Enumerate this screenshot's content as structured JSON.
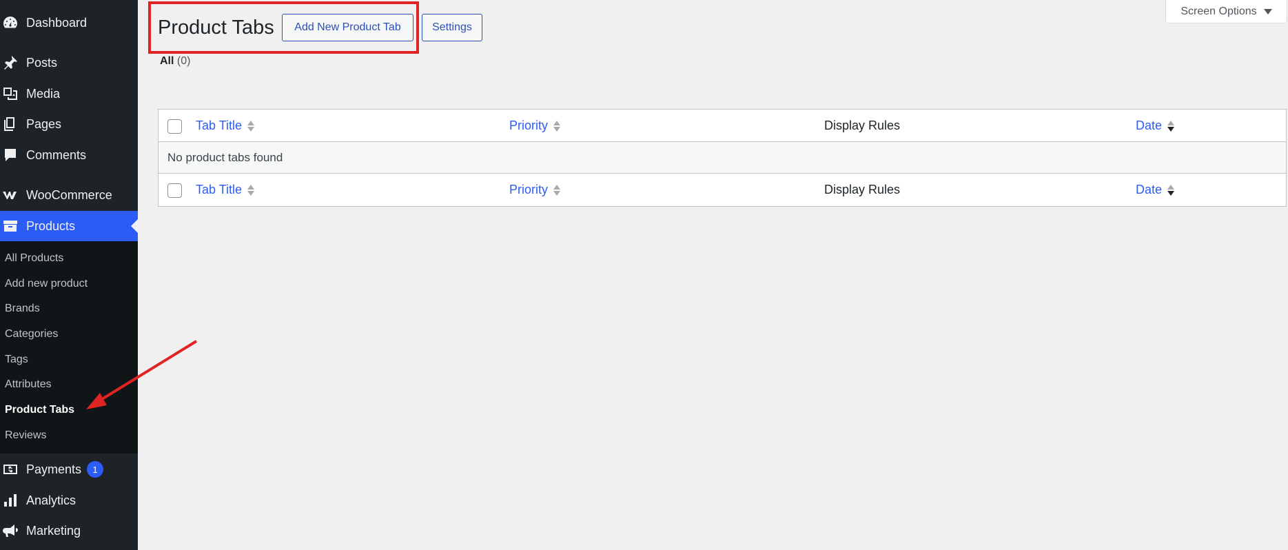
{
  "sidebar": {
    "items": [
      {
        "label": "Dashboard",
        "icon": "dashboard-icon"
      },
      {
        "label": "Posts",
        "icon": "pin-icon"
      },
      {
        "label": "Media",
        "icon": "media-icon"
      },
      {
        "label": "Pages",
        "icon": "pages-icon"
      },
      {
        "label": "Comments",
        "icon": "comment-icon"
      },
      {
        "label": "WooCommerce",
        "icon": "woocommerce-icon"
      },
      {
        "label": "Products",
        "icon": "archive-icon"
      },
      {
        "label": "Payments",
        "icon": "payments-icon",
        "badge": "1"
      },
      {
        "label": "Analytics",
        "icon": "bar-chart-icon"
      },
      {
        "label": "Marketing",
        "icon": "megaphone-icon"
      }
    ],
    "submenu": [
      {
        "label": "All Products"
      },
      {
        "label": "Add new product"
      },
      {
        "label": "Brands"
      },
      {
        "label": "Categories"
      },
      {
        "label": "Tags"
      },
      {
        "label": "Attributes"
      },
      {
        "label": "Product Tabs"
      },
      {
        "label": "Reviews"
      }
    ]
  },
  "screen_options": {
    "label": "Screen Options"
  },
  "header": {
    "title": "Product Tabs",
    "add_new_label": "Add New Product Tab",
    "settings_label": "Settings"
  },
  "filters": {
    "all_label": "All",
    "all_count": "(0)"
  },
  "table": {
    "columns": [
      "Tab Title",
      "Priority",
      "Display Rules",
      "Date"
    ],
    "empty_message": "No product tabs found"
  },
  "colors": {
    "accent": "#2c5cf6",
    "sidebar_bg": "#1d2327",
    "annotation": "#e02424"
  }
}
